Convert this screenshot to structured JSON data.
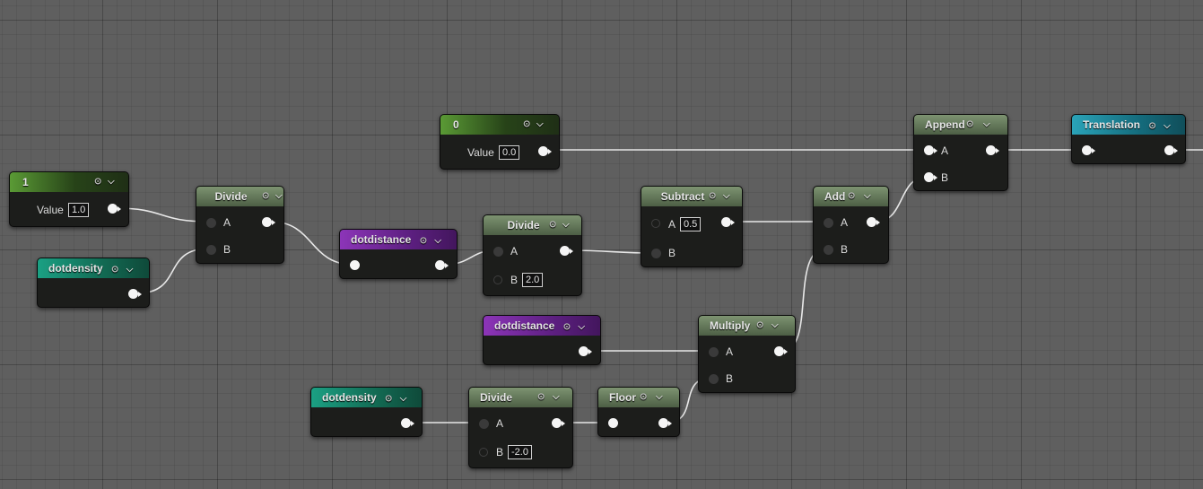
{
  "nodes": {
    "const1": {
      "title": "1",
      "value_label": "Value",
      "value": "1.0"
    },
    "const0": {
      "title": "0",
      "value_label": "Value",
      "value": "0.0"
    },
    "dotdensity1": {
      "title": "dotdensity"
    },
    "dotdensity2": {
      "title": "dotdensity"
    },
    "divide1": {
      "title": "Divide",
      "pin_a": "A",
      "pin_b": "B"
    },
    "dotdistance1": {
      "title": "dotdistance"
    },
    "dotdistance2": {
      "title": "dotdistance"
    },
    "divide2": {
      "title": "Divide",
      "pin_a": "A",
      "pin_b": "B",
      "b_value": "2.0"
    },
    "subtract": {
      "title": "Subtract",
      "pin_a": "A",
      "pin_b": "B",
      "a_value": "0.5"
    },
    "add": {
      "title": "Add",
      "pin_a": "A",
      "pin_b": "B"
    },
    "append": {
      "title": "Append",
      "pin_a": "A",
      "pin_b": "B"
    },
    "translation": {
      "title": "Translation"
    },
    "multiply": {
      "title": "Multiply",
      "pin_a": "A",
      "pin_b": "B"
    },
    "divide3": {
      "title": "Divide",
      "pin_a": "A",
      "pin_b": "B",
      "b_value": "-2.0"
    },
    "floor": {
      "title": "Floor"
    }
  },
  "colors": {
    "background": "#5f5f5f",
    "node_body": "#1c1d1b",
    "operator_header": "#5f7456",
    "constant_header": "#5a9a35",
    "parameter_header": "#1ba083",
    "curve_header": "#8c35b8",
    "translation_header": "#2aa3b8",
    "wire": "#e8e8e8"
  },
  "icons": [
    "pin-icon",
    "preview-icon",
    "chevron-down-icon"
  ]
}
